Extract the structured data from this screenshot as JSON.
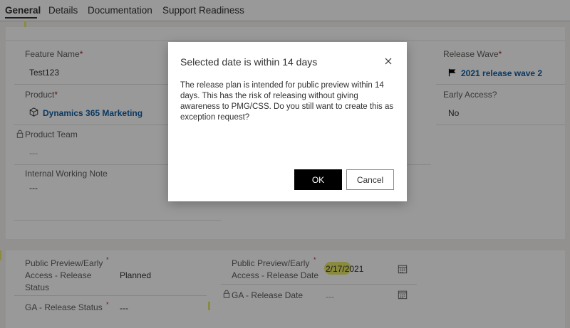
{
  "tabs": [
    "General",
    "Details",
    "Documentation",
    "Support Readiness"
  ],
  "form": {
    "feature_name": {
      "label": "Feature Name",
      "required_mark": "*",
      "value": "Test123"
    },
    "product": {
      "label": "Product",
      "required_mark": "*",
      "value": "Dynamics 365 Marketing"
    },
    "product_team": {
      "label": "Product Team",
      "value": "---"
    },
    "internal_working_note": {
      "label": "Internal Working Note",
      "value": "---"
    },
    "release_wave": {
      "label": "Release Wave",
      "required_mark": "*",
      "value": "2021 release wave 2"
    },
    "early_access": {
      "label": "Early Access?",
      "value": "No"
    }
  },
  "release": {
    "preview_status": {
      "label_line1": "Public Preview/Early",
      "label_line2": "Access - Release",
      "label_line3": "Status",
      "required_mark": "*",
      "value": "Planned"
    },
    "ga_status": {
      "label": "GA - Release Status",
      "required_mark": "*",
      "value": "---"
    },
    "preview_date": {
      "label_line1": "Public Preview/Early",
      "label_line2": "Access - Release Date",
      "required_mark": "*",
      "value": "2/17/2021"
    },
    "ga_date": {
      "label": "GA - Release Date",
      "value": "---"
    }
  },
  "dialog": {
    "title": "Selected date is within 14 days",
    "message": "The release plan is intended for public preview within 14 days. This has the risk of releasing without giving awareness to PMG/CSS. Do you still want to create this as exception request?",
    "ok_label": "OK",
    "cancel_label": "Cancel"
  },
  "colors": {
    "link": "#115ea3",
    "required": "#a4262c",
    "highlight": "#e8e86a",
    "primary_button": "#000000"
  },
  "icons": [
    "cube-icon",
    "flag-icon",
    "lock-icon",
    "calendar-icon",
    "close-icon"
  ]
}
